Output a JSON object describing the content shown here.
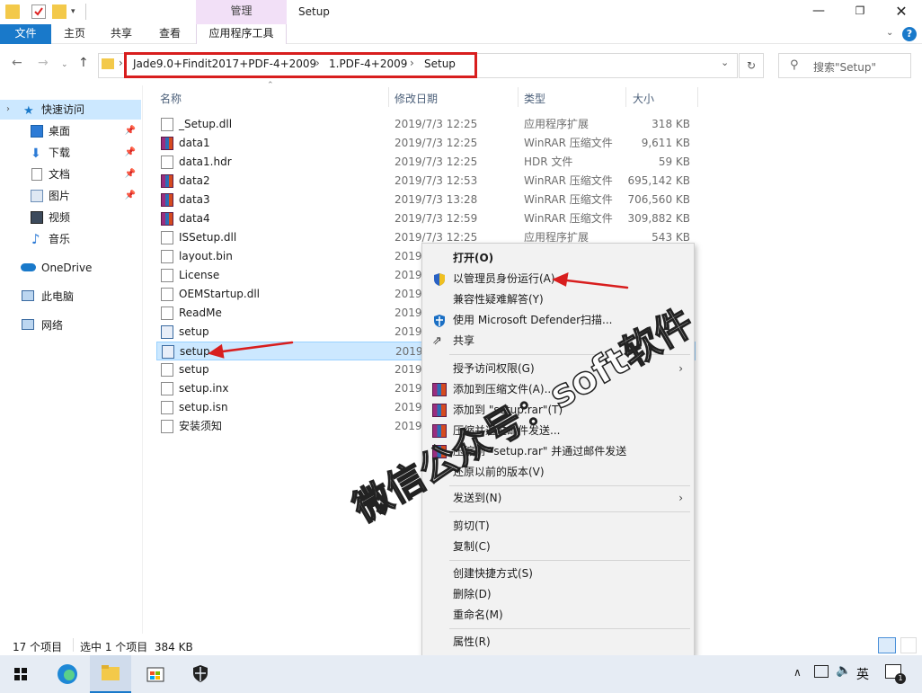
{
  "window": {
    "title": "Setup",
    "contextual_tab_group": "管理"
  },
  "ribbon": {
    "tabs": [
      {
        "label": "文件"
      },
      {
        "label": "主页"
      },
      {
        "label": "共享"
      },
      {
        "label": "查看"
      },
      {
        "label": "应用程序工具"
      }
    ]
  },
  "address_bar": {
    "breadcrumbs": [
      "Jade9.0+Findit2017+PDF-4+2009",
      "1.PDF-4+2009",
      "Setup"
    ],
    "search_placeholder": "搜索\"Setup\""
  },
  "nav_pane": {
    "quick_access": "快速访问",
    "items": [
      {
        "label": "桌面",
        "icon": "desktop-icon",
        "pinned": true
      },
      {
        "label": "下载",
        "icon": "download-icon",
        "pinned": true
      },
      {
        "label": "文档",
        "icon": "document-icon",
        "pinned": true
      },
      {
        "label": "图片",
        "icon": "picture-icon",
        "pinned": true
      },
      {
        "label": "视频",
        "icon": "video-icon",
        "pinned": false
      },
      {
        "label": "音乐",
        "icon": "music-icon",
        "pinned": false
      }
    ],
    "onedrive": "OneDrive",
    "this_pc": "此电脑",
    "network": "网络"
  },
  "file_list": {
    "columns": {
      "name": "名称",
      "date": "修改日期",
      "type": "类型",
      "size": "大小"
    },
    "rows": [
      {
        "name": "_Setup.dll",
        "date": "2019/7/3 12:25",
        "type": "应用程序扩展",
        "size": "318 KB",
        "icon": "dll"
      },
      {
        "name": "data1",
        "date": "2019/7/3 12:25",
        "type": "WinRAR 压缩文件",
        "size": "9,611 KB",
        "icon": "rar"
      },
      {
        "name": "data1.hdr",
        "date": "2019/7/3 12:25",
        "type": "HDR 文件",
        "size": "59 KB",
        "icon": "doc"
      },
      {
        "name": "data2",
        "date": "2019/7/3 12:53",
        "type": "WinRAR 压缩文件",
        "size": "695,142 KB",
        "icon": "rar"
      },
      {
        "name": "data3",
        "date": "2019/7/3 13:28",
        "type": "WinRAR 压缩文件",
        "size": "706,560 KB",
        "icon": "rar"
      },
      {
        "name": "data4",
        "date": "2019/7/3 12:59",
        "type": "WinRAR 压缩文件",
        "size": "309,882 KB",
        "icon": "rar"
      },
      {
        "name": "ISSetup.dll",
        "date": "2019/7/3 12:25",
        "type": "应用程序扩展",
        "size": "543 KB",
        "icon": "dll"
      },
      {
        "name": "layout.bin",
        "date": "2019/",
        "type": "",
        "size": "",
        "icon": "doc"
      },
      {
        "name": "License",
        "date": "2019/",
        "type": "",
        "size": "",
        "icon": "doc"
      },
      {
        "name": "OEMStartup.dll",
        "date": "2019/",
        "type": "",
        "size": "",
        "icon": "dll"
      },
      {
        "name": "ReadMe",
        "date": "2019/",
        "type": "",
        "size": "",
        "icon": "doc"
      },
      {
        "name": "setup",
        "date": "2019/",
        "type": "",
        "size": "",
        "icon": "app"
      },
      {
        "name": "setup",
        "date": "2019/",
        "type": "",
        "size": "",
        "icon": "app",
        "selected": true
      },
      {
        "name": "setup",
        "date": "2019/",
        "type": "",
        "size": "",
        "icon": "doc"
      },
      {
        "name": "setup.inx",
        "date": "2019/",
        "type": "",
        "size": "",
        "icon": "doc"
      },
      {
        "name": "setup.isn",
        "date": "2019/",
        "type": "",
        "size": "",
        "icon": "doc"
      },
      {
        "name": "安装须知",
        "date": "2019/",
        "type": "",
        "size": "",
        "icon": "doc"
      }
    ]
  },
  "context_menu": {
    "items": [
      {
        "label": "打开(O)",
        "bold": true
      },
      {
        "label": "以管理员身份运行(A)",
        "icon": "shield-icon"
      },
      {
        "label": "兼容性疑难解答(Y)"
      },
      {
        "label": "使用 Microsoft Defender扫描...",
        "icon": "defender-icon"
      },
      {
        "label": "共享",
        "icon": "share-icon"
      },
      {
        "label": "授予访问权限(G)",
        "submenu": true
      },
      {
        "label": "添加到压缩文件(A)...",
        "icon": "winrar-icon"
      },
      {
        "label": "添加到 \"setup.rar\"(T)",
        "icon": "winrar-icon"
      },
      {
        "label": "压缩并通过邮件发送...",
        "icon": "winrar-icon"
      },
      {
        "label": "压缩到 \"setup.rar\" 并通过邮件发送",
        "icon": "winrar-icon"
      },
      {
        "label": "还原以前的版本(V)"
      },
      {
        "label": "发送到(N)",
        "submenu": true
      },
      {
        "label": "剪切(T)"
      },
      {
        "label": "复制(C)"
      },
      {
        "label": "创建快捷方式(S)"
      },
      {
        "label": "删除(D)"
      },
      {
        "label": "重命名(M)"
      },
      {
        "label": "属性(R)"
      }
    ]
  },
  "status_bar": {
    "item_count": "17 个项目",
    "selection": "选中 1 个项目  384 KB"
  },
  "taskbar": {
    "ime": "英",
    "notification_count": "1"
  },
  "watermark": "微信公众号：soft软件",
  "colors": {
    "accent": "#1979ca",
    "highlight_red": "#d81e1e",
    "selection": "#cce8ff"
  }
}
